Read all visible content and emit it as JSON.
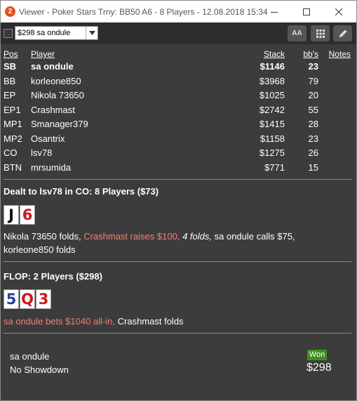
{
  "window": {
    "app_icon_text": "2",
    "title": "Viewer - Poker Stars Trny: BB50 A6 - 8 Players - 12.08.2018 15:34",
    "minimize_icon": "minimize-icon",
    "maximize_icon": "maximize-icon",
    "close_icon": "close-icon"
  },
  "toolbar": {
    "hand_select_value": "$298 sa ondule",
    "font_button_label": "AA",
    "grid_icon": "grid-icon",
    "edit_icon": "pencil-icon"
  },
  "table": {
    "headers": {
      "pos": "Pos",
      "player": "Player",
      "stack": "Stack",
      "bbs": "bb's",
      "notes": "Notes"
    },
    "players": [
      {
        "pos": "SB",
        "name": "sa ondule",
        "stack": "$1146",
        "bbs": "23"
      },
      {
        "pos": "BB",
        "name": "korleone850",
        "stack": "$3968",
        "bbs": "79"
      },
      {
        "pos": "EP",
        "name": "Nikola 73650",
        "stack": "$1025",
        "bbs": "20"
      },
      {
        "pos": "EP1",
        "name": "Crashmast",
        "stack": "$2742",
        "bbs": "55"
      },
      {
        "pos": "MP1",
        "name": "Smanager379",
        "stack": "$1415",
        "bbs": "28"
      },
      {
        "pos": "MP2",
        "name": "Osantrix",
        "stack": "$1158",
        "bbs": "23"
      },
      {
        "pos": "CO",
        "name": "lsv78",
        "stack": "$1275",
        "bbs": "26"
      },
      {
        "pos": "BTN",
        "name": "mrsumida",
        "stack": "$771",
        "bbs": "15"
      }
    ]
  },
  "preflop": {
    "heading": "Dealt to lsv78 in CO: 8 Players ($73)",
    "cards": [
      {
        "rank": "J",
        "suit": "spade"
      },
      {
        "rank": "6",
        "suit": "heart"
      }
    ],
    "actions": {
      "part1": "Nikola 73650 folds, ",
      "part2": "Crashmast raises $100, ",
      "part3": "4 folds, ",
      "part4": "sa ondule calls $75,",
      "part5": "korleone850 folds"
    }
  },
  "flop": {
    "heading": "FLOP: 2 Players ($298)",
    "cards": [
      {
        "rank": "5",
        "suit": "diamond"
      },
      {
        "rank": "Q",
        "suit": "heart"
      },
      {
        "rank": "3",
        "suit": "heart"
      }
    ],
    "actions": {
      "part1": "sa ondule bets $1040 all-in, ",
      "part2": "Crashmast folds"
    }
  },
  "result": {
    "winner": "sa ondule",
    "showdown": "No Showdown",
    "badge": "Won",
    "amount": "$298"
  },
  "colors": {
    "background": "#3c3c3c",
    "aggressive_action": "#f08070",
    "won_badge": "#3f8f1f"
  }
}
